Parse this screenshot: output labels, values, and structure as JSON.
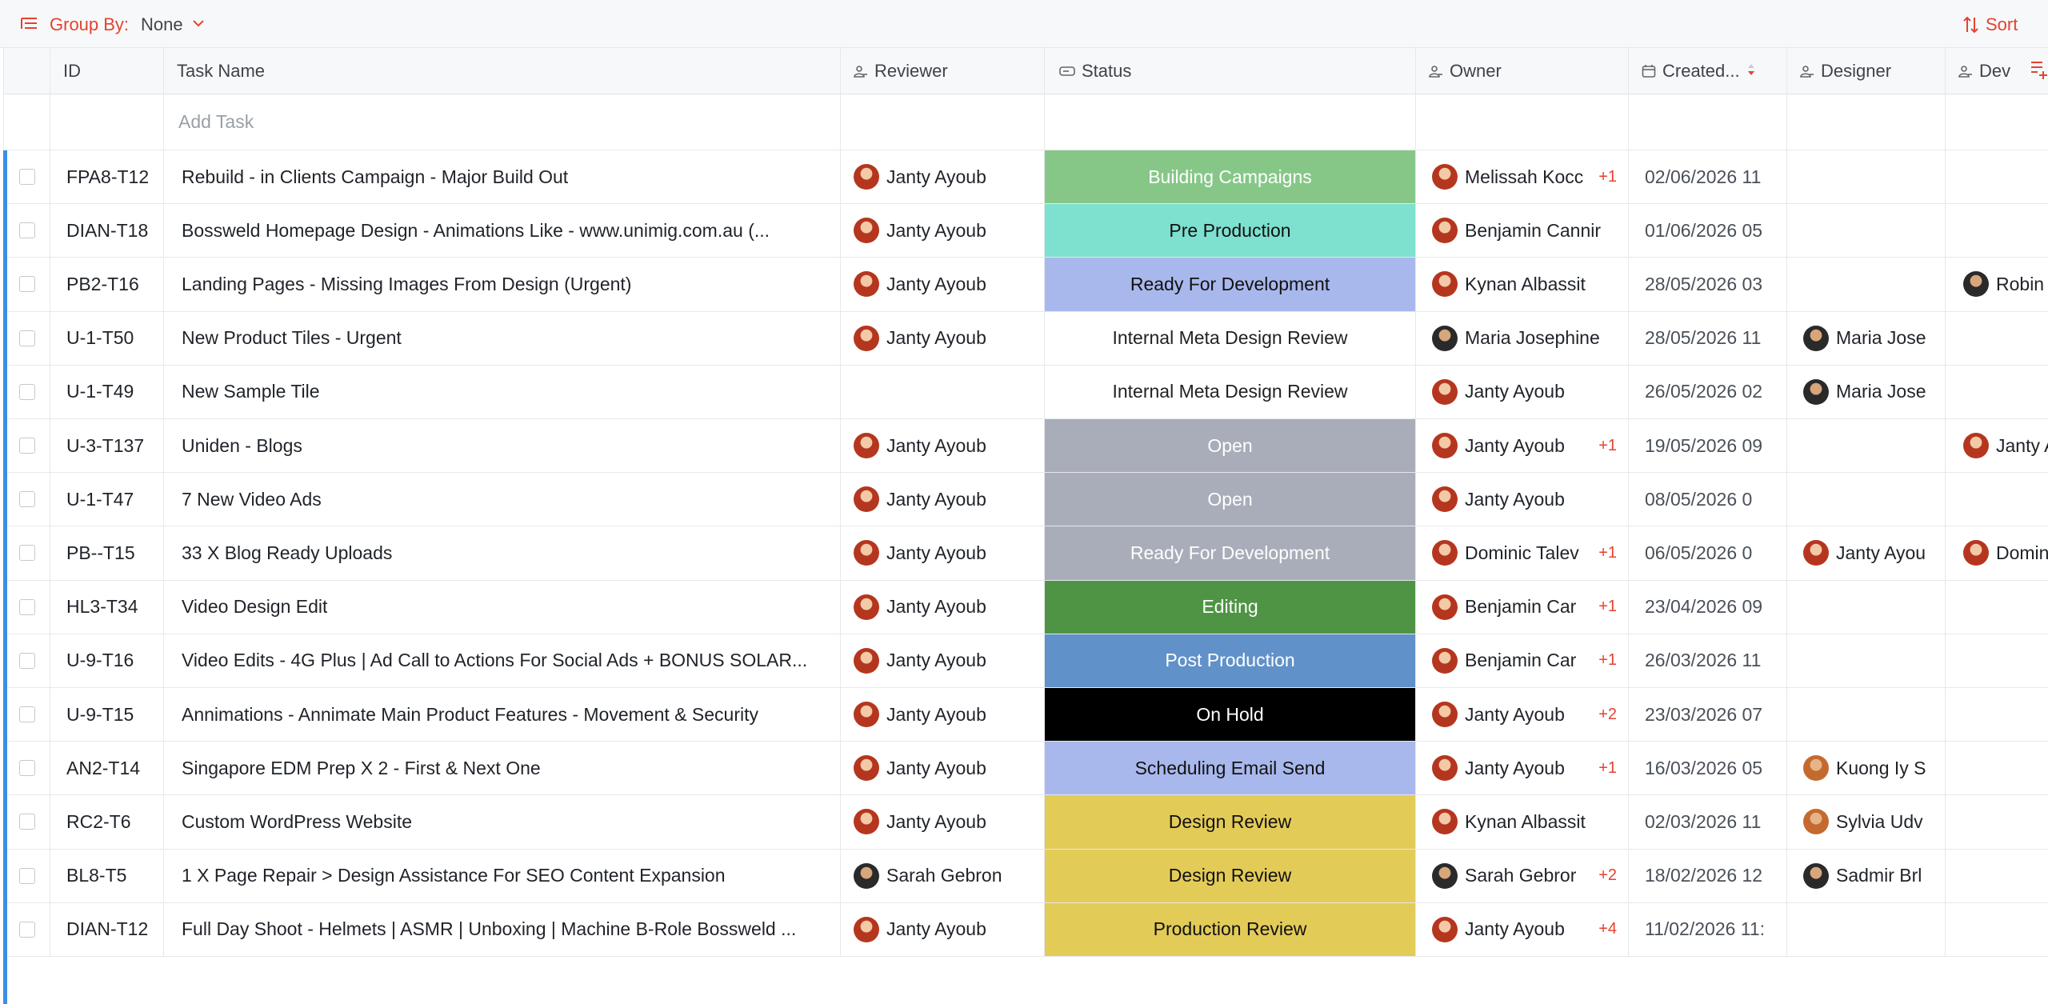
{
  "toolbar": {
    "group_by_label": "Group By:",
    "group_by_value": "None",
    "sort_label": "Sort",
    "accent_color": "#e5422f"
  },
  "columns": {
    "id": "ID",
    "task_name": "Task Name",
    "reviewer": "Reviewer",
    "status": "Status",
    "owner": "Owner",
    "created": "Created...",
    "designer": "Designer",
    "developer": "Dev"
  },
  "add_task_placeholder": "Add Task",
  "rows": [
    {
      "id": "FPA8-T12",
      "task": "Rebuild - in Clients Campaign - Major Build Out",
      "reviewer": "Janty Ayoub",
      "status": "Building Campaigns",
      "status_bg": "#86c788",
      "status_fg": "#ffffff",
      "owner": "Melissah Kocc",
      "owner_extra": "+1",
      "created": "02/06/2026 11",
      "designer": "",
      "developer": ""
    },
    {
      "id": "DIAN-T18",
      "task": "Bossweld Homepage Design - Animations Like - www.unimig.com.au (...",
      "reviewer": "Janty Ayoub",
      "status": "Pre Production",
      "status_bg": "#7ee0cf",
      "status_fg": "#111111",
      "owner": "Benjamin Cannir",
      "owner_extra": "",
      "created": "01/06/2026 05",
      "designer": "",
      "developer": ""
    },
    {
      "id": "PB2-T16",
      "task": "Landing Pages - Missing Images From Design (Urgent)",
      "reviewer": "Janty Ayoub",
      "status": "Ready For Development",
      "status_bg": "#a9b8ec",
      "status_fg": "#111111",
      "owner": "Kynan Albassit",
      "owner_extra": "",
      "created": "28/05/2026 03",
      "designer": "",
      "developer": "Robin"
    },
    {
      "id": "U-1-T50",
      "task": "New Product Tiles - Urgent",
      "reviewer": "Janty Ayoub",
      "status": "Internal Meta Design Review",
      "status_bg": "",
      "status_fg": "#222222",
      "owner": "Maria Josephine",
      "owner_extra": "",
      "created": "28/05/2026 11",
      "designer": "Maria Jose",
      "developer": ""
    },
    {
      "id": "U-1-T49",
      "task": "New Sample Tile",
      "reviewer": "",
      "status": "Internal Meta Design Review",
      "status_bg": "",
      "status_fg": "#222222",
      "owner": "Janty Ayoub",
      "owner_extra": "",
      "created": "26/05/2026 02",
      "designer": "Maria Jose",
      "developer": ""
    },
    {
      "id": "U-3-T137",
      "task": "Uniden - Blogs",
      "reviewer": "Janty Ayoub",
      "status": "Open",
      "status_bg": "#a8adb9",
      "status_fg": "#ffffff",
      "owner": "Janty Ayoub",
      "owner_extra": "+1",
      "created": "19/05/2026 09",
      "designer": "",
      "developer": "Janty A"
    },
    {
      "id": "U-1-T47",
      "task": "7 New Video Ads",
      "reviewer": "Janty Ayoub",
      "status": "Open",
      "status_bg": "#a8adb9",
      "status_fg": "#ffffff",
      "owner": "Janty Ayoub",
      "owner_extra": "",
      "created": "08/05/2026 0",
      "designer": "",
      "developer": ""
    },
    {
      "id": "PB--T15",
      "task": "33 X Blog Ready Uploads",
      "reviewer": "Janty Ayoub",
      "status": "Ready For Development",
      "status_bg": "#a8adb9",
      "status_fg": "#ffffff",
      "owner": "Dominic Talev",
      "owner_extra": "+1",
      "created": "06/05/2026 0",
      "designer": "Janty Ayou",
      "developer": "Domin"
    },
    {
      "id": "HL3-T34",
      "task": "Video Design Edit",
      "reviewer": "Janty Ayoub",
      "status": "Editing",
      "status_bg": "#4f9444",
      "status_fg": "#ffffff",
      "owner": "Benjamin Car",
      "owner_extra": "+1",
      "created": "23/04/2026 09",
      "designer": "",
      "developer": ""
    },
    {
      "id": "U-9-T16",
      "task": "Video Edits - 4G Plus | Ad Call to Actions For Social Ads + BONUS SOLAR...",
      "reviewer": "Janty Ayoub",
      "status": "Post Production",
      "status_bg": "#6191c9",
      "status_fg": "#ffffff",
      "owner": "Benjamin Car",
      "owner_extra": "+1",
      "created": "26/03/2026 11",
      "designer": "",
      "developer": ""
    },
    {
      "id": "U-9-T15",
      "task": "Annimations - Annimate Main Product Features - Movement & Security",
      "reviewer": "Janty Ayoub",
      "status": "On Hold",
      "status_bg": "#000000",
      "status_fg": "#ffffff",
      "owner": "Janty Ayoub",
      "owner_extra": "+2",
      "created": "23/03/2026 07",
      "designer": "",
      "developer": ""
    },
    {
      "id": "AN2-T14",
      "task": "Singapore EDM Prep X 2 - First & Next One",
      "reviewer": "Janty Ayoub",
      "status": "Scheduling Email Send",
      "status_bg": "#a9b8ec",
      "status_fg": "#111111",
      "owner": "Janty Ayoub",
      "owner_extra": "+1",
      "created": "16/03/2026 05",
      "designer": "Kuong Iy S",
      "developer": ""
    },
    {
      "id": "RC2-T6",
      "task": "Custom WordPress Website",
      "reviewer": "Janty Ayoub",
      "status": "Design Review",
      "status_bg": "#e3cb58",
      "status_fg": "#111111",
      "owner": "Kynan Albassit",
      "owner_extra": "",
      "created": "02/03/2026 11",
      "designer": "Sylvia Udv",
      "developer": ""
    },
    {
      "id": "BL8-T5",
      "task": "1 X Page Repair > Design Assistance For SEO Content Expansion",
      "reviewer": "Sarah Gebron",
      "status": "Design Review",
      "status_bg": "#e3cb58",
      "status_fg": "#111111",
      "owner": "Sarah Gebror",
      "owner_extra": "+2",
      "created": "18/02/2026 12",
      "designer": "Sadmir Brl",
      "developer": ""
    },
    {
      "id": "DIAN-T12",
      "task": "Full Day Shoot - Helmets | ASMR | Unboxing | Machine B-Role Bossweld ...",
      "reviewer": "Janty Ayoub",
      "status": "Production Review",
      "status_bg": "#e3cb58",
      "status_fg": "#111111",
      "owner": "Janty Ayoub",
      "owner_extra": "+4",
      "created": "11/02/2026 11:",
      "designer": "",
      "developer": ""
    }
  ]
}
